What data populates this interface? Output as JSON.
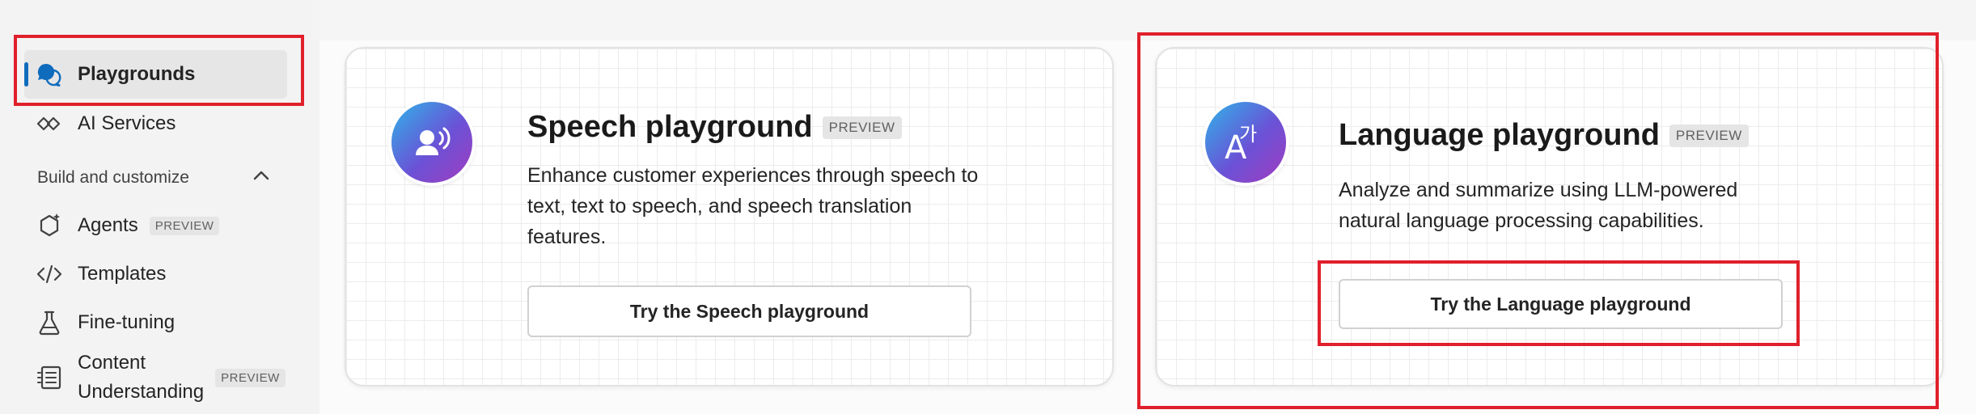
{
  "sidebar": {
    "items": [
      {
        "label": "Playgrounds",
        "icon": "chat-bubbles-icon",
        "active": true
      },
      {
        "label": "AI Services",
        "icon": "diamond-icon"
      },
      {
        "label": "Agents",
        "icon": "agent-hexagon-icon",
        "badge": "PREVIEW"
      },
      {
        "label": "Templates",
        "icon": "code-icon"
      },
      {
        "label": "Fine-tuning",
        "icon": "flask-icon"
      },
      {
        "label": "Content\nUnderstanding",
        "icon": "document-list-icon",
        "badge": "PREVIEW"
      }
    ],
    "section_header": "Build and customize",
    "section_expanded": true
  },
  "cards": {
    "speech": {
      "title": "Speech playground",
      "badge": "PREVIEW",
      "description": "Enhance customer experiences through speech to text, text to speech, and speech translation features.",
      "button_label": "Try the Speech playground",
      "icon": "speech-person-icon"
    },
    "language": {
      "title": "Language playground",
      "badge": "PREVIEW",
      "description": "Analyze and summarize using LLM-powered natural language processing capabilities.",
      "button_label": "Try the Language playground",
      "icon": "translate-icon"
    }
  },
  "colors": {
    "accent": "#0f6cbd",
    "annotation": "#e0202b",
    "avatar_gradient": [
      "#2fb4e8",
      "#6a52d6",
      "#a23cbf"
    ]
  }
}
